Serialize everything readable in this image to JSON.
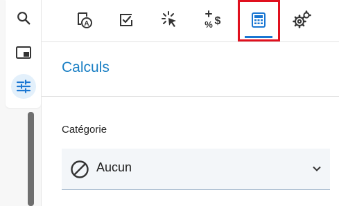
{
  "sidebar": {
    "items": [
      {
        "name": "search-icon"
      },
      {
        "name": "panel-layout-icon"
      },
      {
        "name": "sliders-icon",
        "active": true
      }
    ]
  },
  "tabs": [
    {
      "icon": "map-pin-a-icon",
      "active": false
    },
    {
      "icon": "checkbox-icon",
      "active": false
    },
    {
      "icon": "cursor-click-icon",
      "active": false
    },
    {
      "icon": "plus-percent-dollar-icon",
      "active": false
    },
    {
      "icon": "calculator-icon",
      "active": true
    },
    {
      "icon": "gears-icon",
      "active": false
    }
  ],
  "panel": {
    "title": "Calculs",
    "category": {
      "label": "Catégorie",
      "selected": "Aucun",
      "icon": "none-icon"
    }
  },
  "colors": {
    "accent": "#1976d2",
    "title": "#1a7fc4",
    "highlight": "#e0101e"
  }
}
